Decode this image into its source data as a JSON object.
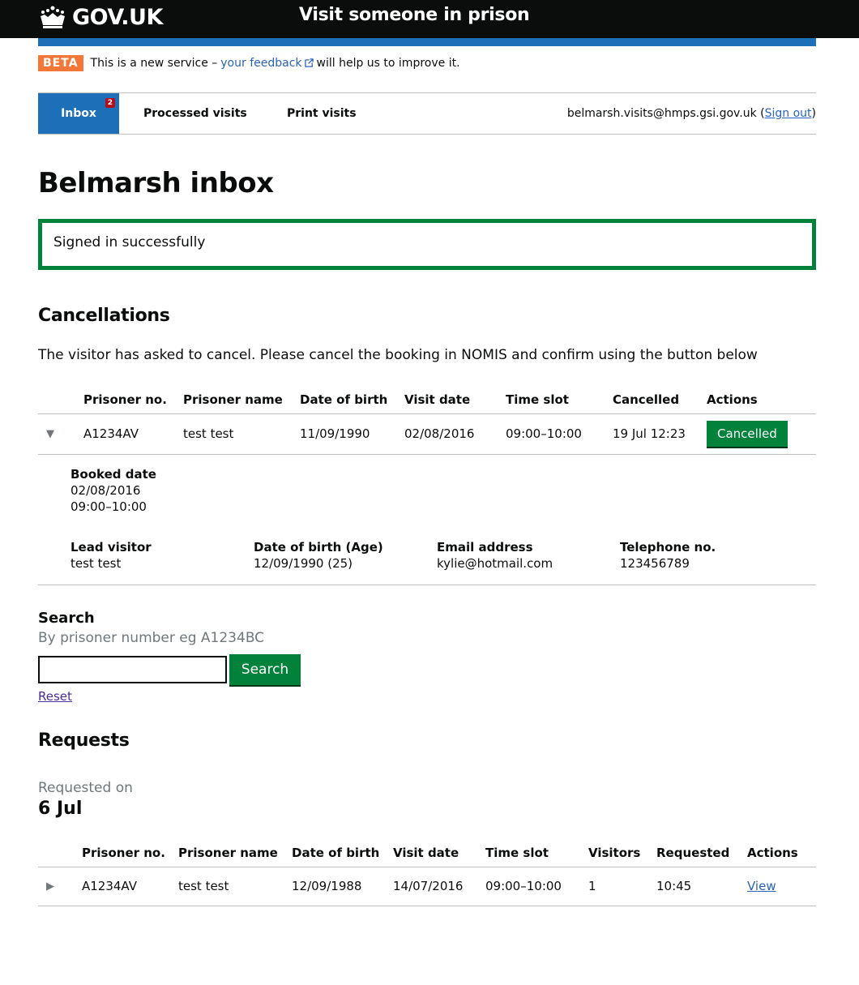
{
  "header": {
    "logo_text": "GOV.UK",
    "service_name": "Visit someone in prison"
  },
  "phase": {
    "tag": "BETA",
    "text_before": "This is a new service –",
    "link": "your feedback",
    "text_after": "will help us to improve it."
  },
  "nav": {
    "items": [
      {
        "label": "Inbox",
        "badge": "2",
        "active": true
      },
      {
        "label": "Processed visits",
        "active": false
      },
      {
        "label": "Print visits",
        "active": false
      }
    ],
    "user_email": "belmarsh.visits@hmps.gsi.gov.uk",
    "sign_out": "Sign out"
  },
  "page": {
    "title": "Belmarsh inbox",
    "flash": "Signed in successfully"
  },
  "cancellations": {
    "heading": "Cancellations",
    "instructions": "The visitor has asked to cancel. Please cancel the booking in NOMIS and confirm using the button below",
    "columns": [
      "Prisoner no.",
      "Prisoner name",
      "Date of birth",
      "Visit date",
      "Time slot",
      "Cancelled",
      "Actions"
    ],
    "row": {
      "toggle": "▼",
      "prisoner_no": "A1234AV",
      "prisoner_name": "test test",
      "dob": "11/09/1990",
      "visit_date": "02/08/2016",
      "time_slot": "09:00–10:00",
      "cancelled": "19 Jul 12:23",
      "action": "Cancelled"
    },
    "details": {
      "booked_label": "Booked date",
      "booked_date": "02/08/2016",
      "booked_time": "09:00–10:00",
      "lead_visitor_label": "Lead visitor",
      "lead_visitor": "test test",
      "dob_label": "Date of birth (Age)",
      "dob": "12/09/1990 (25)",
      "email_label": "Email address",
      "email": "kylie@hotmail.com",
      "phone_label": "Telephone no.",
      "phone": "123456789"
    }
  },
  "search": {
    "label": "Search",
    "hint": "By prisoner number eg A1234BC",
    "value": "",
    "button": "Search",
    "reset": "Reset"
  },
  "requests": {
    "heading": "Requests",
    "requested_on_label": "Requested on",
    "date": "6 Jul",
    "columns": [
      "Prisoner no.",
      "Prisoner name",
      "Date of birth",
      "Visit date",
      "Time slot",
      "Visitors",
      "Requested",
      "Actions"
    ],
    "row": {
      "toggle": "▶",
      "prisoner_no": "A1234AV",
      "prisoner_name": "test test",
      "dob": "12/09/1988",
      "visit_date": "14/07/2016",
      "time_slot": "09:00–10:00",
      "visitors": "1",
      "requested": "10:45",
      "action": "View"
    }
  },
  "colors": {
    "header_bg": "#0b0c0c",
    "brand_blue": "#1d70b8",
    "beta_orange": "#f47738",
    "success_green": "#00823b",
    "link_blue": "#2b62bd"
  }
}
